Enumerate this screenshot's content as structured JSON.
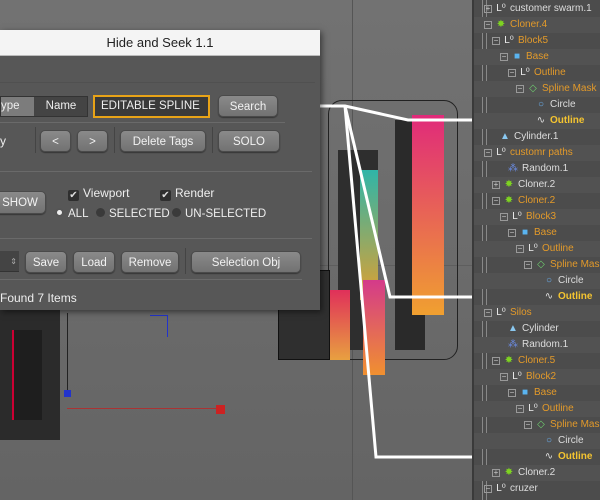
{
  "dialog": {
    "title": "Hide and Seek 1.1",
    "search_mode_type": "ype",
    "search_mode_name": "Name",
    "search_input": "EDITABLE SPLINE",
    "search_button": "Search",
    "row2_label": "y",
    "prev_button": "<",
    "next_button": ">",
    "delete_tags_button": "Delete Tags",
    "solo_button": "SOLO",
    "show_button": "SHOW",
    "viewport_checkbox": "Viewport",
    "render_checkbox": "Render",
    "radio_all": "ALL",
    "radio_selected": "SELECTED",
    "radio_unselected": "UN-SELECTED",
    "save_button": "Save",
    "load_button": "Load",
    "remove_button": "Remove",
    "selection_obj_button": "Selection Obj",
    "status": "Found 7 Items"
  },
  "colors": {
    "accent": "#e8a317",
    "object_orange": "#e39a2a",
    "highlight_yellow": "#f4c430"
  },
  "hierarchy": [
    {
      "name": "customer swarm.1",
      "icon": "null-icon",
      "level": 0,
      "exp": "+",
      "style": "white"
    },
    {
      "name": "Cloner.4",
      "icon": "cloner-icon",
      "level": 0,
      "exp": "-",
      "style": "orange"
    },
    {
      "name": "Block5",
      "icon": "null-icon",
      "level": 1,
      "exp": "-",
      "style": "orange"
    },
    {
      "name": "Base",
      "icon": "cube-icon",
      "level": 2,
      "exp": "-",
      "style": "orange"
    },
    {
      "name": "Outline",
      "icon": "null-icon",
      "level": 3,
      "exp": "-",
      "style": "orange"
    },
    {
      "name": "Spline Mask",
      "icon": "spline-mask-icon",
      "level": 4,
      "exp": "-",
      "style": "orange"
    },
    {
      "name": "Circle",
      "icon": "circle-icon",
      "level": 5,
      "exp": "",
      "style": "white"
    },
    {
      "name": "Outline",
      "icon": "spline-icon",
      "level": 5,
      "exp": "",
      "style": "yellow"
    },
    {
      "name": "Cylinder.1",
      "icon": "cylinder-icon",
      "level": 0.5,
      "exp": "",
      "style": "white"
    },
    {
      "name": "customr paths",
      "icon": "null-icon",
      "level": 0,
      "exp": "-",
      "style": "orange"
    },
    {
      "name": "Random.1",
      "icon": "random-effector-icon",
      "level": 1.5,
      "exp": "",
      "style": "white"
    },
    {
      "name": "Cloner.2",
      "icon": "cloner-icon",
      "level": 1,
      "exp": "+",
      "style": "white"
    },
    {
      "name": "Cloner.2",
      "icon": "cloner-icon",
      "level": 1,
      "exp": "-",
      "style": "orange"
    },
    {
      "name": "Block3",
      "icon": "null-icon",
      "level": 2,
      "exp": "-",
      "style": "orange"
    },
    {
      "name": "Base",
      "icon": "cube-icon",
      "level": 3,
      "exp": "-",
      "style": "orange"
    },
    {
      "name": "Outline",
      "icon": "null-icon",
      "level": 4,
      "exp": "-",
      "style": "orange"
    },
    {
      "name": "Spline Mask",
      "icon": "spline-mask-icon",
      "level": 5,
      "exp": "-",
      "style": "orange"
    },
    {
      "name": "Circle",
      "icon": "circle-icon",
      "level": 6,
      "exp": "",
      "style": "white"
    },
    {
      "name": "Outline",
      "icon": "spline-icon",
      "level": 6,
      "exp": "",
      "style": "yellow"
    },
    {
      "name": "Silos",
      "icon": "null-icon",
      "level": 0,
      "exp": "-",
      "style": "orange"
    },
    {
      "name": "Cylinder",
      "icon": "cylinder-icon",
      "level": 1.5,
      "exp": "",
      "style": "white"
    },
    {
      "name": "Random.1",
      "icon": "random-effector-icon",
      "level": 1.5,
      "exp": "",
      "style": "white"
    },
    {
      "name": "Cloner.5",
      "icon": "cloner-icon",
      "level": 1,
      "exp": "-",
      "style": "orange"
    },
    {
      "name": "Block2",
      "icon": "null-icon",
      "level": 2,
      "exp": "-",
      "style": "orange"
    },
    {
      "name": "Base",
      "icon": "cube-icon",
      "level": 3,
      "exp": "-",
      "style": "orange"
    },
    {
      "name": "Outline",
      "icon": "null-icon",
      "level": 4,
      "exp": "-",
      "style": "orange"
    },
    {
      "name": "Spline Mask",
      "icon": "spline-mask-icon",
      "level": 5,
      "exp": "-",
      "style": "orange"
    },
    {
      "name": "Circle",
      "icon": "circle-icon",
      "level": 6,
      "exp": "",
      "style": "white"
    },
    {
      "name": "Outline",
      "icon": "spline-icon",
      "level": 6,
      "exp": "",
      "style": "yellow"
    },
    {
      "name": "Cloner.2",
      "icon": "cloner-icon",
      "level": 1,
      "exp": "+",
      "style": "white"
    },
    {
      "name": "cruzer",
      "icon": "null-icon",
      "level": 0,
      "exp": "-",
      "style": "white"
    }
  ]
}
